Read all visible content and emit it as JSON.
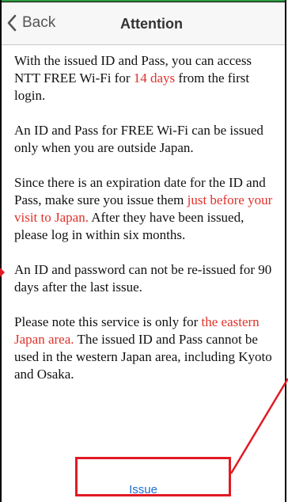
{
  "nav": {
    "back_label": "Back",
    "title": "Attention"
  },
  "content": {
    "p1_a": "With the issued ID and Pass, you can access NTT FREE Wi-Fi for ",
    "p1_red": "14 days",
    "p1_b": " from the first login.",
    "p2": "An ID and Pass for FREE Wi-Fi can be issued only when you are outside Japan.",
    "p3_a": "Since there is an expiration date for the ID and Pass, make sure you issue them ",
    "p3_red": "just before your visit to Japan.",
    "p3_b": " After they have been issued, please log in within six months.",
    "p4": "An ID and password can not be re-issued for 90 days after the last issue.",
    "p5_a": "Please note this service is only for ",
    "p5_red": "the eastern Japan area.",
    "p5_b": " The issued ID and Pass cannot be used in the western Japan area, including Kyoto and Osaka."
  },
  "actions": {
    "issue_label": "Issue"
  },
  "colors": {
    "accent_red": "#e0312a",
    "link_blue": "#1b6fd6",
    "highlight_red": "#e01b24"
  },
  "icons": {
    "back": "chevron-left-icon"
  }
}
